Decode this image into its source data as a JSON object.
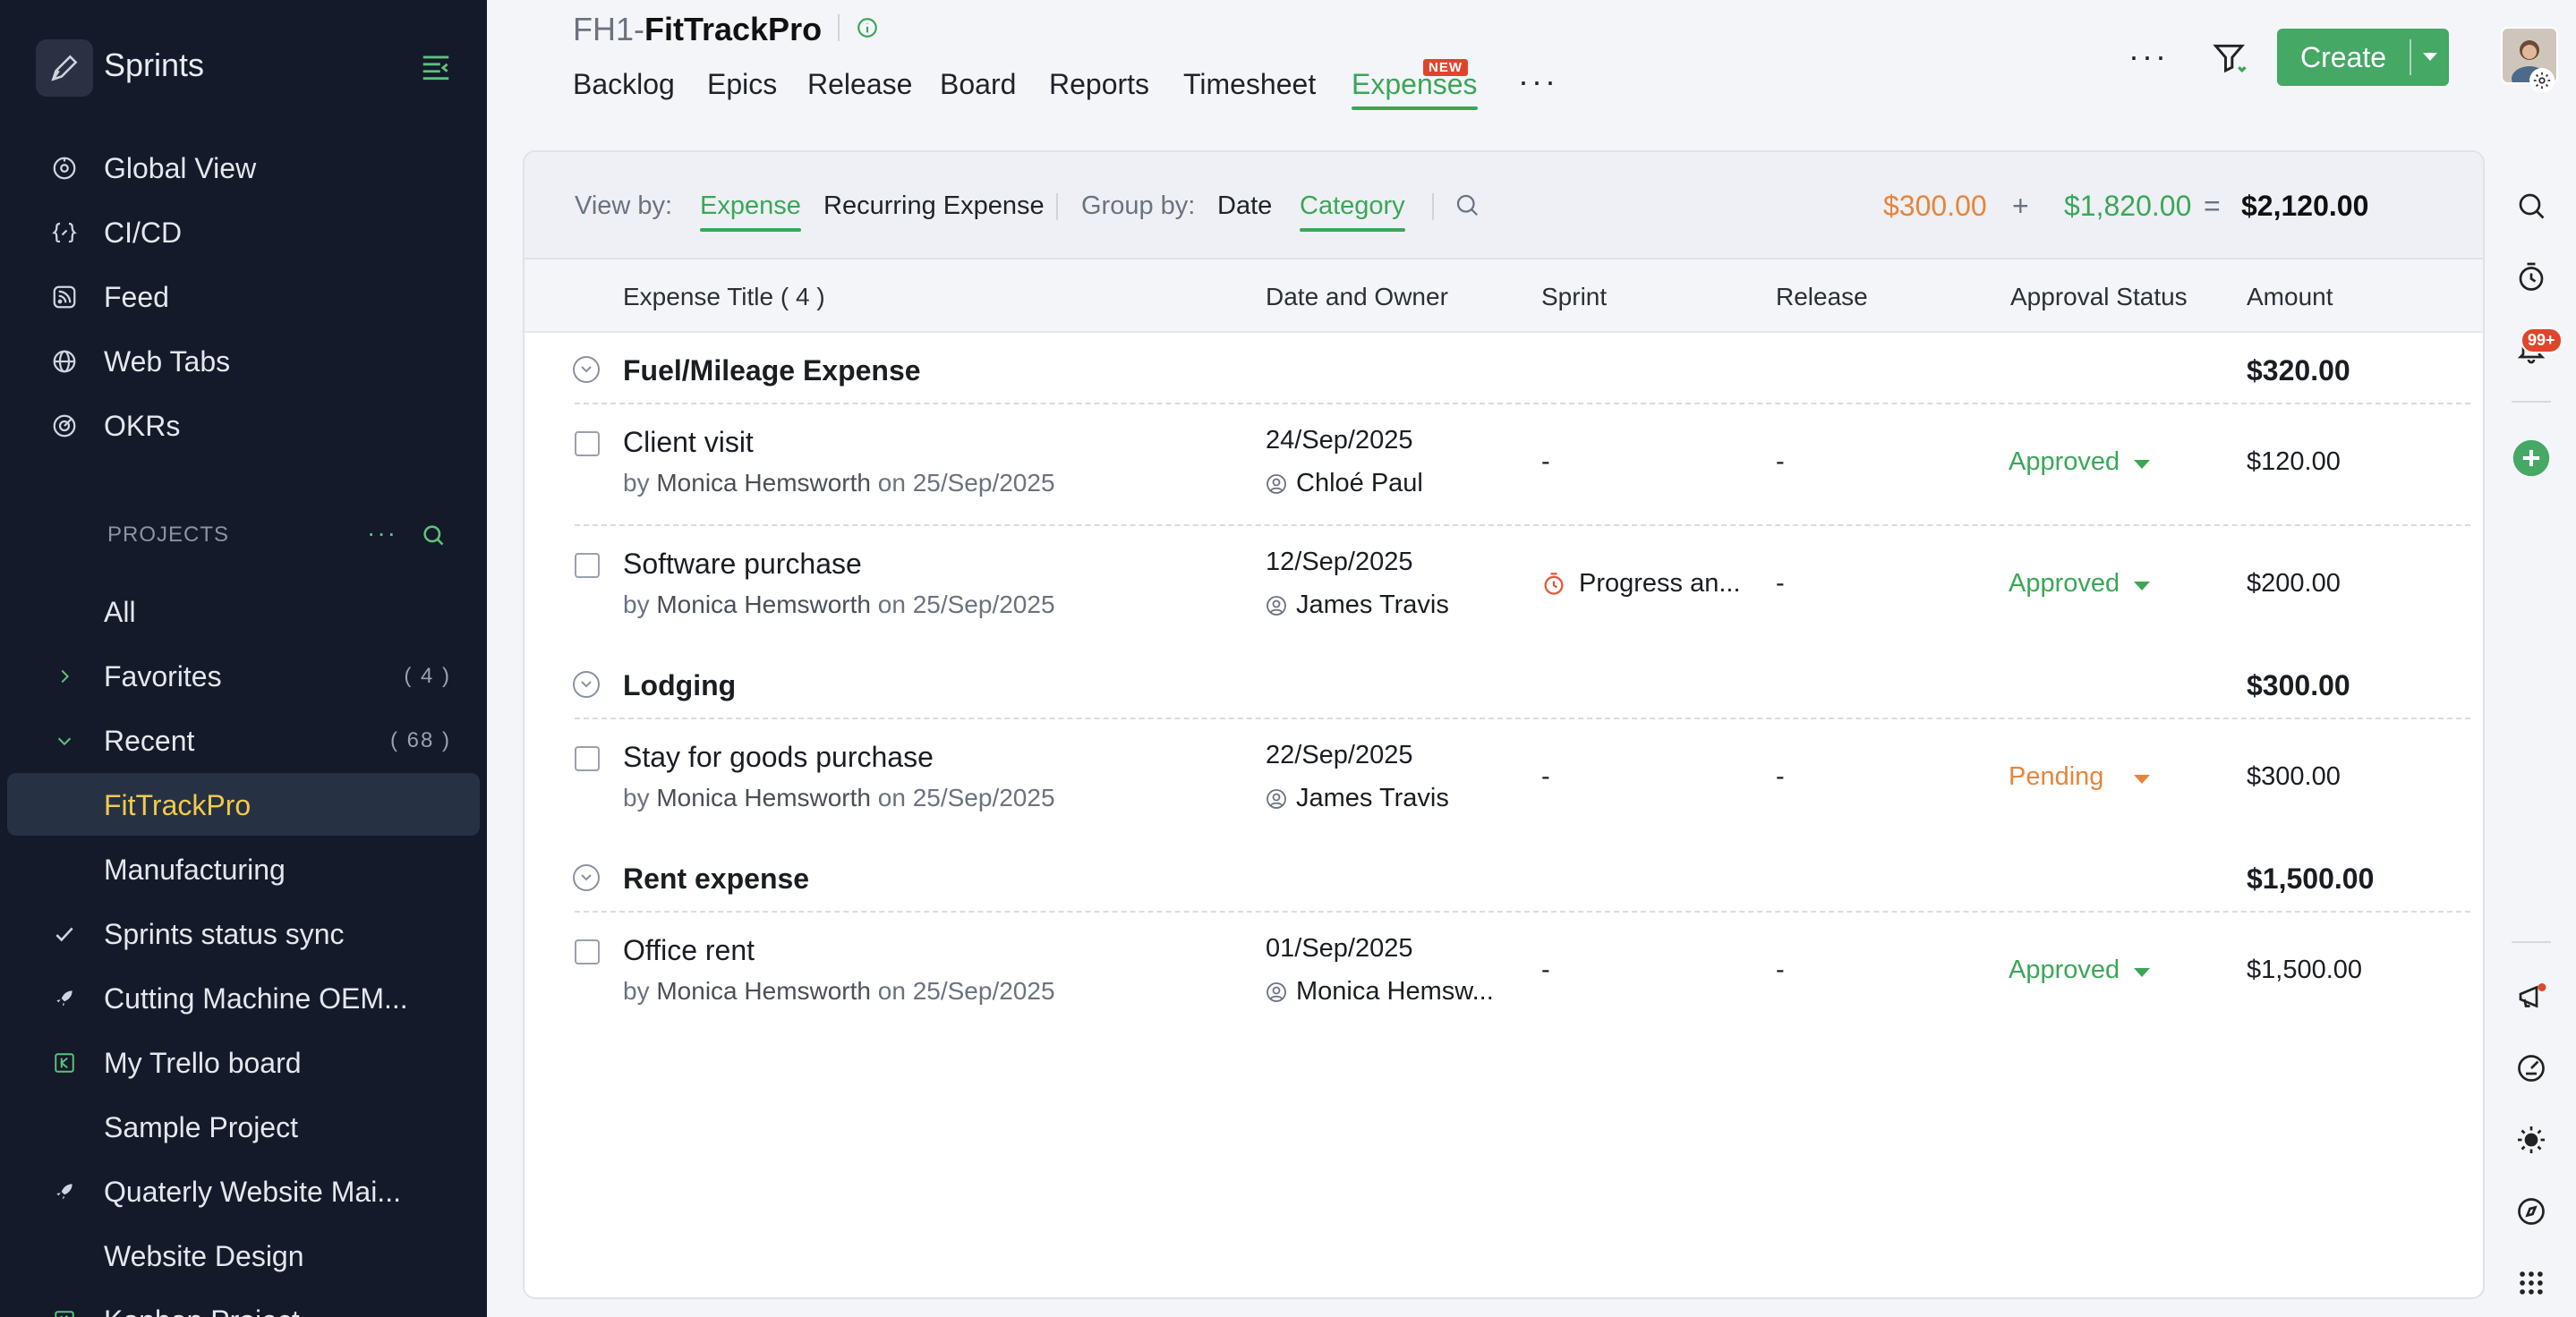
{
  "sidebar": {
    "app_title": "Sprints",
    "nav": [
      {
        "label": "Global View",
        "icon": "global-view-icon"
      },
      {
        "label": "CI/CD",
        "icon": "cicd-icon"
      },
      {
        "label": "Feed",
        "icon": "feed-icon"
      },
      {
        "label": "Web Tabs",
        "icon": "globe-icon"
      },
      {
        "label": "OKRs",
        "icon": "okr-target-icon"
      }
    ],
    "projects_heading": "PROJECTS",
    "projects_more": "···",
    "project_groups": [
      {
        "label": "All"
      },
      {
        "label": "Favorites",
        "count": "( 4 )"
      },
      {
        "label": "Recent",
        "count": "( 68 )"
      }
    ],
    "projects": [
      {
        "label": "FitTrackPro",
        "active": true
      },
      {
        "label": "Manufacturing"
      },
      {
        "label": "Sprints status sync"
      },
      {
        "label": "Cutting Machine OEM..."
      },
      {
        "label": "My Trello board"
      },
      {
        "label": "Sample Project"
      },
      {
        "label": "Quaterly Website Mai..."
      },
      {
        "label": "Website Design"
      },
      {
        "label": "Kanban Project"
      }
    ]
  },
  "header": {
    "project_key": "FH1-",
    "project_name": "FitTrackPro",
    "tabs": [
      "Backlog",
      "Epics",
      "Release",
      "Board",
      "Reports",
      "Timesheet",
      "Expenses"
    ],
    "active_tab": "Expenses",
    "new_badge": "NEW",
    "more": "···",
    "create_label": "Create"
  },
  "toolbar": {
    "view_by_label": "View by:",
    "view_options": [
      "Expense",
      "Recurring Expense"
    ],
    "group_by_label": "Group by:",
    "group_options": [
      "Date",
      "Category"
    ],
    "totals": {
      "pending": "$300.00",
      "plus": "+",
      "approved": "$1,820.00",
      "equals": "=",
      "total": "$2,120.00"
    }
  },
  "table": {
    "columns": [
      "Expense Title ( 4 )",
      "Date and Owner",
      "Sprint",
      "Release",
      "Approval Status",
      "Amount"
    ],
    "groups": [
      {
        "name": "Fuel/Mileage Expense",
        "amount": "$320.00",
        "rows": [
          {
            "title": "Client visit",
            "by_prefix": "by",
            "by_name": "Monica Hemsworth",
            "on_text": "on 25/Sep/2025",
            "date": "24/Sep/2025",
            "owner": "Chloé Paul",
            "sprint": "-",
            "release": "-",
            "status": "Approved",
            "amount": "$120.00"
          },
          {
            "title": "Software purchase",
            "by_prefix": "by",
            "by_name": "Monica Hemsworth",
            "on_text": "on 25/Sep/2025",
            "date": "12/Sep/2025",
            "owner": "James Travis",
            "sprint": "Progress an...",
            "release": "-",
            "status": "Approved",
            "amount": "$200.00"
          }
        ]
      },
      {
        "name": "Lodging",
        "amount": "$300.00",
        "rows": [
          {
            "title": "Stay for goods purchase",
            "by_prefix": "by",
            "by_name": "Monica Hemsworth",
            "on_text": "on 25/Sep/2025",
            "date": "22/Sep/2025",
            "owner": "James Travis",
            "sprint": "-",
            "release": "-",
            "status": "Pending",
            "amount": "$300.00"
          }
        ]
      },
      {
        "name": "Rent expense",
        "amount": "$1,500.00",
        "rows": [
          {
            "title": "Office rent",
            "by_prefix": "by",
            "by_name": "Monica Hemsworth",
            "on_text": "on 25/Sep/2025",
            "date": "01/Sep/2025",
            "owner": "Monica Hemsw...",
            "sprint": "-",
            "release": "-",
            "status": "Approved",
            "amount": "$1,500.00"
          }
        ]
      }
    ]
  },
  "rail": {
    "notification_badge": "99+"
  },
  "colors": {
    "accent_green": "#3aa757",
    "pending_orange": "#e8843a",
    "sidebar_bg": "#141a2a",
    "active_project": "#f3c94a",
    "badge_red": "#e0452b"
  }
}
